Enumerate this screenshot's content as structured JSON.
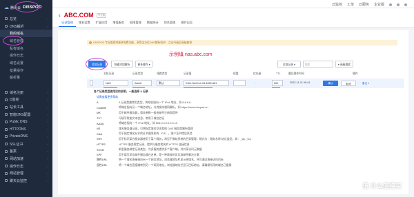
{
  "brand": {
    "vendor": "腾讯云",
    "name": "DNSPOD"
  },
  "sidebar": {
    "items": [
      {
        "label": "总览",
        "type": "item"
      },
      {
        "label": "DNS解析",
        "type": "item"
      },
      {
        "label": "我的域名",
        "type": "sub",
        "active": true
      },
      {
        "label": "域名管理",
        "type": "sub"
      },
      {
        "label": "私有域名",
        "type": "sub"
      },
      {
        "label": "操作日志",
        "type": "sub"
      },
      {
        "label": "域名设置",
        "type": "sub"
      },
      {
        "label": "批量操作",
        "type": "sub"
      },
      {
        "label": "解析量",
        "type": "sub"
      },
      {
        "label": "",
        "type": "gap"
      },
      {
        "label": "域名注册",
        "type": "item"
      },
      {
        "label": "D监控",
        "type": "item"
      },
      {
        "label": "站长工具",
        "type": "item"
      },
      {
        "label": "智能DNS配置",
        "type": "item"
      },
      {
        "label": "Public DNS",
        "type": "item"
      },
      {
        "label": "HTTPDNS",
        "type": "item"
      },
      {
        "label": "PrivateDNS",
        "type": "item"
      },
      {
        "label": "SSL证书",
        "type": "item"
      },
      {
        "label": "备案",
        "type": "item"
      },
      {
        "label": "网站加速",
        "type": "item"
      },
      {
        "label": "操作日志",
        "type": "item"
      },
      {
        "label": "网站管理",
        "type": "item"
      },
      {
        "label": "聚天云监控",
        "type": "item"
      }
    ]
  },
  "topbar": {
    "links": [
      "云监控",
      "工单",
      "云服务",
      "企业版"
    ]
  },
  "domain": {
    "title": "ABC.COM",
    "badge": "专业版",
    "back": "‹"
  },
  "tabs": [
    "记录管理",
    "域名设置",
    "扩展应用",
    "增值服务",
    "权限管理",
    "数据统计",
    "别名管理",
    "操作日志"
  ],
  "notice": "DNSPOD 专业版提供更多免费功能，享受全方位DNS解析防护，点击升级至高级套餐",
  "annotation": "示例填 nas.abc.com",
  "toolbar": {
    "add": "添加记录",
    "quick": "快速添加解析",
    "more": "更多操作 ▾",
    "filter": "全部记录 ▾",
    "search_placeholder": "搜索",
    "advanced": "▾ 高级搜索"
  },
  "table": {
    "headers": [
      "主机记录",
      "记录类型",
      "线路类型",
      "记录值",
      "权重",
      "优先级",
      "TTL",
      "最后操作时间",
      "操作"
    ],
    "edit_row": {
      "host": "NAS",
      "type": "AAAA",
      "line": "默认",
      "value": "240e:3b4:1c1:2d:4820:d81",
      "weight": "",
      "priority": "-",
      "ttl": "600",
      "time": "2022-11-11 09:41",
      "confirm": "确认",
      "cancel": "取消",
      "note": "备注 ▾"
    }
  },
  "help": {
    "heading": "各个记录类型使用目的说明，一般选择 A 记录",
    "subtitle": "如需查看更多帮助",
    "rows": [
      {
        "k": "A",
        "v": "A 记录是最常用类型，将域名指向一个 IPv4 地址，如 8.8.8.8"
      },
      {
        "k": "CNAME",
        "v": "将域名指向另一个域名地址，与其保持相同解析，如 https://www.dnspod.cn"
      },
      {
        "k": "MX",
        "v": "用于邮件服务器，相关参数一般由邮件注册商提供"
      },
      {
        "k": "TXT",
        "v": "可填写附加文本信息，常用于域名验证"
      },
      {
        "k": "AAAA",
        "v": "将域名指向一个 IPv6 地址，如 ff06:0:0:0:0:0:0:c3"
      },
      {
        "k": "NS",
        "v": "域名服务器记录，可将指定域名交由其他 DNS 服务商解析管理"
      },
      {
        "k": "CAA",
        "v": "用于指定域名允许的证书颁发机构（CA），减少证书错误风险"
      },
      {
        "k": "SRV",
        "v": "用于标识某台服务器使用了某个服务，常见于微软系统的目录管理，格式为：服务名称.协议类型，如：_sip._tcp"
      },
      {
        "k": "HTTPS",
        "v": "HTTPS 服务绑定记录，提供与服务相关的 HTTPS 连接信息"
      },
      {
        "k": "SVCB",
        "v": "新型服务绑定记录类型，为多服务提供多个客户端，并共享访问元数据"
      },
      {
        "k": "SPF",
        "v": "用于填写发信邮件服务器白名单，是一种高效的反垃圾邮件解决方案"
      },
      {
        "k": "隐性URL",
        "v": "将一个域名直接指向另一个网页地址，浏览器地址栏显示原域名，并可通过直接访问目标"
      },
      {
        "k": "显性URL",
        "v": "将一个域名直接跳转到另一个网页地址，浏览器地址栏显示目标地址，请确保所用的域名已备案"
      }
    ]
  },
  "watermark": "值 什么值得买"
}
